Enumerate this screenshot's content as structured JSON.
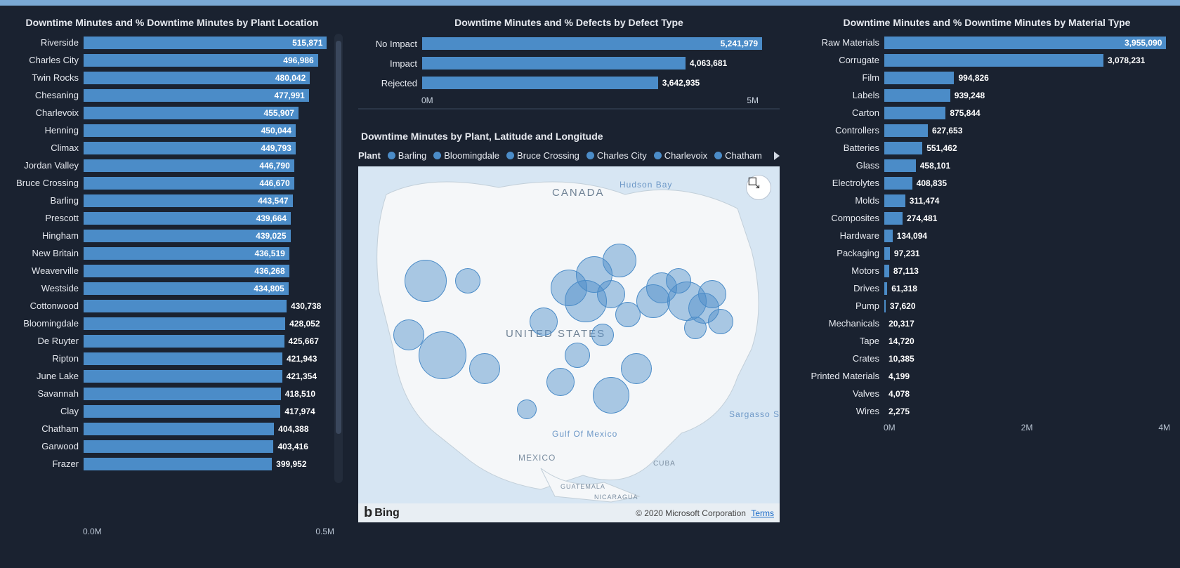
{
  "chart_data": [
    {
      "id": "plant",
      "type": "bar",
      "orientation": "horizontal",
      "title": "Downtime Minutes and % Downtime Minutes by Plant Location",
      "xlabel": "",
      "ylabel": "",
      "xlim": [
        0,
        530000
      ],
      "xticks": [
        "0.0M",
        "0.5M"
      ],
      "categories": [
        "Riverside",
        "Charles City",
        "Twin Rocks",
        "Chesaning",
        "Charlevoix",
        "Henning",
        "Climax",
        "Jordan Valley",
        "Bruce Crossing",
        "Barling",
        "Prescott",
        "Hingham",
        "New Britain",
        "Weaverville",
        "Westside",
        "Cottonwood",
        "Bloomingdale",
        "De Ruyter",
        "Ripton",
        "June Lake",
        "Savannah",
        "Clay",
        "Chatham",
        "Garwood",
        "Frazer"
      ],
      "values": [
        515871,
        496986,
        480042,
        477991,
        455907,
        450044,
        449793,
        446790,
        446670,
        443547,
        439664,
        439025,
        436519,
        436268,
        434805,
        430738,
        428052,
        425667,
        421943,
        421354,
        418510,
        417974,
        404388,
        403416,
        399952
      ],
      "value_labels": [
        "515,871",
        "496,986",
        "480,042",
        "477,991",
        "455,907",
        "450,044",
        "449,793",
        "446,790",
        "446,670",
        "443,547",
        "439,664",
        "439,025",
        "436,519",
        "436,268",
        "434,805",
        "430,738",
        "428,052",
        "425,667",
        "421,943",
        "421,354",
        "418,510",
        "417,974",
        "404,388",
        "403,416",
        "399,952"
      ]
    },
    {
      "id": "defect",
      "type": "bar",
      "orientation": "horizontal",
      "title": "Downtime Minutes and % Defects by Defect Type",
      "xlim": [
        0,
        5500000
      ],
      "xticks": [
        "0M",
        "5M"
      ],
      "categories": [
        "No Impact",
        "Impact",
        "Rejected"
      ],
      "values": [
        5241979,
        4063681,
        3642935
      ],
      "value_labels": [
        "5,241,979",
        "4,063,681",
        "3,642,935"
      ]
    },
    {
      "id": "material",
      "type": "bar",
      "orientation": "horizontal",
      "title": "Downtime Minutes and % Downtime Minutes by Material Type",
      "xlim": [
        0,
        4000000
      ],
      "xticks": [
        "0M",
        "2M",
        "4M"
      ],
      "categories": [
        "Raw Materials",
        "Corrugate",
        "Film",
        "Labels",
        "Carton",
        "Controllers",
        "Batteries",
        "Glass",
        "Electrolytes",
        "Molds",
        "Composites",
        "Hardware",
        "Packaging",
        "Motors",
        "Drives",
        "Pump",
        "Mechanicals",
        "Tape",
        "Crates",
        "Printed Materials",
        "Valves",
        "Wires"
      ],
      "values": [
        3955090,
        3078231,
        994826,
        939248,
        875844,
        627653,
        551462,
        458101,
        408835,
        311474,
        274481,
        134094,
        97231,
        87113,
        61318,
        37620,
        20317,
        14720,
        10385,
        4199,
        4078,
        2275
      ],
      "value_labels": [
        "3,955,090",
        "3,078,231",
        "994,826",
        "939,248",
        "875,844",
        "627,653",
        "551,462",
        "458,101",
        "408,835",
        "311,474",
        "274,481",
        "134,094",
        "97,231",
        "87,113",
        "61,318",
        "37,620",
        "20,317",
        "14,720",
        "10,385",
        "4,199",
        "4,078",
        "2,275"
      ]
    }
  ],
  "map": {
    "title": "Downtime Minutes by Plant, Latitude and Longitude",
    "legend_label": "Plant",
    "legend_items": [
      "Barling",
      "Bloomingdale",
      "Bruce Crossing",
      "Charles City",
      "Charlevoix",
      "Chatham"
    ],
    "labels": {
      "canada": "CANADA",
      "us": "UNITED STATES",
      "mexico": "MEXICO",
      "gulf": "Gulf Of Mexico",
      "hudson": "Hudson Bay",
      "sargasso": "Sargasso S",
      "cuba": "CUBA",
      "guatemala": "GUATEMALA",
      "nicaragua": "NICARAGUA"
    },
    "attribution": "Bing",
    "copyright": "© 2020 Microsoft Corporation",
    "terms": "Terms",
    "bubbles": [
      {
        "x": 16,
        "y": 34,
        "r": 30
      },
      {
        "x": 26,
        "y": 34,
        "r": 18
      },
      {
        "x": 20,
        "y": 56,
        "r": 34
      },
      {
        "x": 12,
        "y": 50,
        "r": 22
      },
      {
        "x": 30,
        "y": 60,
        "r": 22
      },
      {
        "x": 44,
        "y": 46,
        "r": 20
      },
      {
        "x": 50,
        "y": 36,
        "r": 26
      },
      {
        "x": 54,
        "y": 40,
        "r": 30
      },
      {
        "x": 56,
        "y": 32,
        "r": 26
      },
      {
        "x": 60,
        "y": 38,
        "r": 20
      },
      {
        "x": 58,
        "y": 50,
        "r": 16
      },
      {
        "x": 64,
        "y": 44,
        "r": 18
      },
      {
        "x": 52,
        "y": 56,
        "r": 18
      },
      {
        "x": 48,
        "y": 64,
        "r": 20
      },
      {
        "x": 60,
        "y": 68,
        "r": 26
      },
      {
        "x": 66,
        "y": 60,
        "r": 22
      },
      {
        "x": 70,
        "y": 40,
        "r": 24
      },
      {
        "x": 72,
        "y": 36,
        "r": 22
      },
      {
        "x": 76,
        "y": 34,
        "r": 18
      },
      {
        "x": 78,
        "y": 40,
        "r": 28
      },
      {
        "x": 82,
        "y": 42,
        "r": 22
      },
      {
        "x": 84,
        "y": 38,
        "r": 20
      },
      {
        "x": 86,
        "y": 46,
        "r": 18
      },
      {
        "x": 80,
        "y": 48,
        "r": 16
      },
      {
        "x": 62,
        "y": 28,
        "r": 24
      },
      {
        "x": 40,
        "y": 72,
        "r": 14
      }
    ]
  }
}
